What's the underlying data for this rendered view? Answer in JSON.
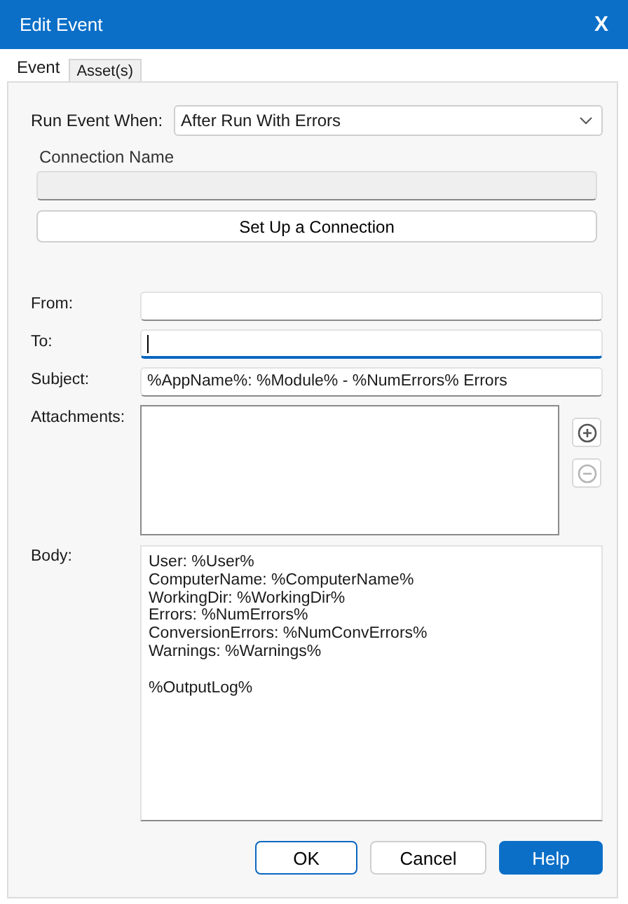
{
  "window": {
    "title": "Edit Event",
    "close": "X"
  },
  "tabs": [
    {
      "label": "Event",
      "selected": true
    },
    {
      "label": "Asset(s)",
      "selected": false
    }
  ],
  "run_event_when": {
    "label": "Run Event When:",
    "value": "After Run With Errors"
  },
  "connection": {
    "label": "Connection Name",
    "disabled": true,
    "button": "Set Up a Connection"
  },
  "fields": [
    {
      "label": "From:",
      "focused": false
    },
    {
      "label": "To:",
      "focused": true
    },
    {
      "label": "Subject:",
      "value": "%AppName%: %Module% - %NumErrors% Errors",
      "focused": false
    }
  ],
  "attachments": {
    "label": "Attachments:",
    "buttons": [
      {
        "kind": "add",
        "disabled": false
      },
      {
        "kind": "remove",
        "disabled": true
      }
    ]
  },
  "body": {
    "label": "Body:",
    "value": "User: %User%\nComputerName: %ComputerName%\nWorkingDir: %WorkingDir%\nErrors: %NumErrors%\nConversionErrors: %NumConvErrors%\nWarnings: %Warnings%\n\n%OutputLog%"
  },
  "buttons": [
    {
      "label": "OK",
      "kind": "default"
    },
    {
      "label": "Cancel",
      "kind": "normal"
    },
    {
      "label": "Help",
      "kind": "primary"
    }
  ]
}
